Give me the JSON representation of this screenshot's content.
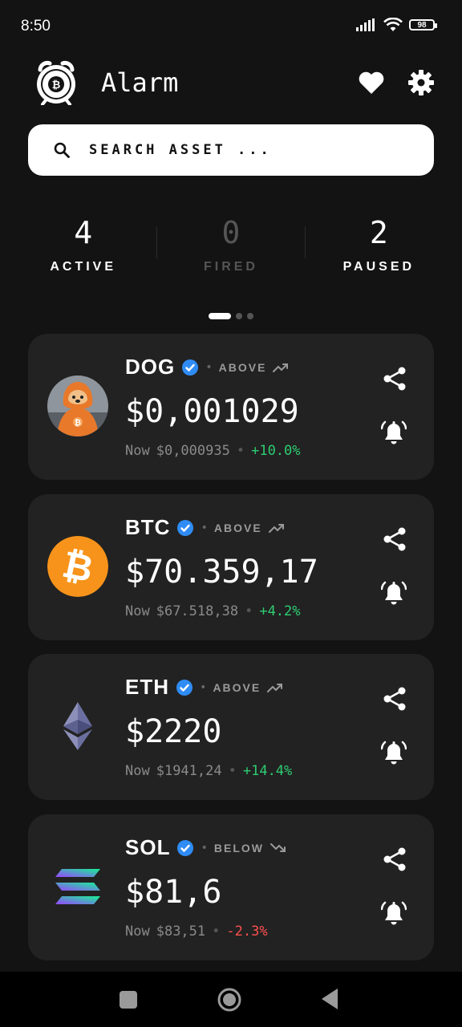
{
  "status": {
    "time": "8:50",
    "battery": "98"
  },
  "header": {
    "title": "Alarm",
    "logo_icon": "bitcoin-alarm-clock-icon"
  },
  "search": {
    "placeholder": "SEARCH ASSET ..."
  },
  "stats": [
    {
      "value": "4",
      "label": "ACTIVE"
    },
    {
      "value": "0",
      "label": "FIRED"
    },
    {
      "value": "2",
      "label": "PAUSED"
    }
  ],
  "pager": {
    "pages": 3,
    "current": 1
  },
  "alarms": [
    {
      "ticker": "DOG",
      "direction": "ABOVE",
      "target": "$0,001029",
      "now_label": "Now",
      "now": "$0,000935",
      "change": "+10.0%",
      "change_type": "positive",
      "icon": "dog-coin-icon"
    },
    {
      "ticker": "BTC",
      "direction": "ABOVE",
      "target": "$70.359,17",
      "now_label": "Now",
      "now": "$67.518,38",
      "change": "+4.2%",
      "change_type": "positive",
      "icon": "bitcoin-icon"
    },
    {
      "ticker": "ETH",
      "direction": "ABOVE",
      "target": "$2220",
      "now_label": "Now",
      "now": "$1941,24",
      "change": "+14.4%",
      "change_type": "positive",
      "icon": "ethereum-icon"
    },
    {
      "ticker": "SOL",
      "direction": "BELOW",
      "target": "$81,6",
      "now_label": "Now",
      "now": "$83,51",
      "change": "-2.3%",
      "change_type": "negative",
      "icon": "solana-icon"
    }
  ],
  "colors": {
    "background": "#131313",
    "card": "#222222",
    "positive": "#2ecc71",
    "negative": "#ff4f4f",
    "verified": "#2f8cf5",
    "btc": "#f7931a"
  }
}
